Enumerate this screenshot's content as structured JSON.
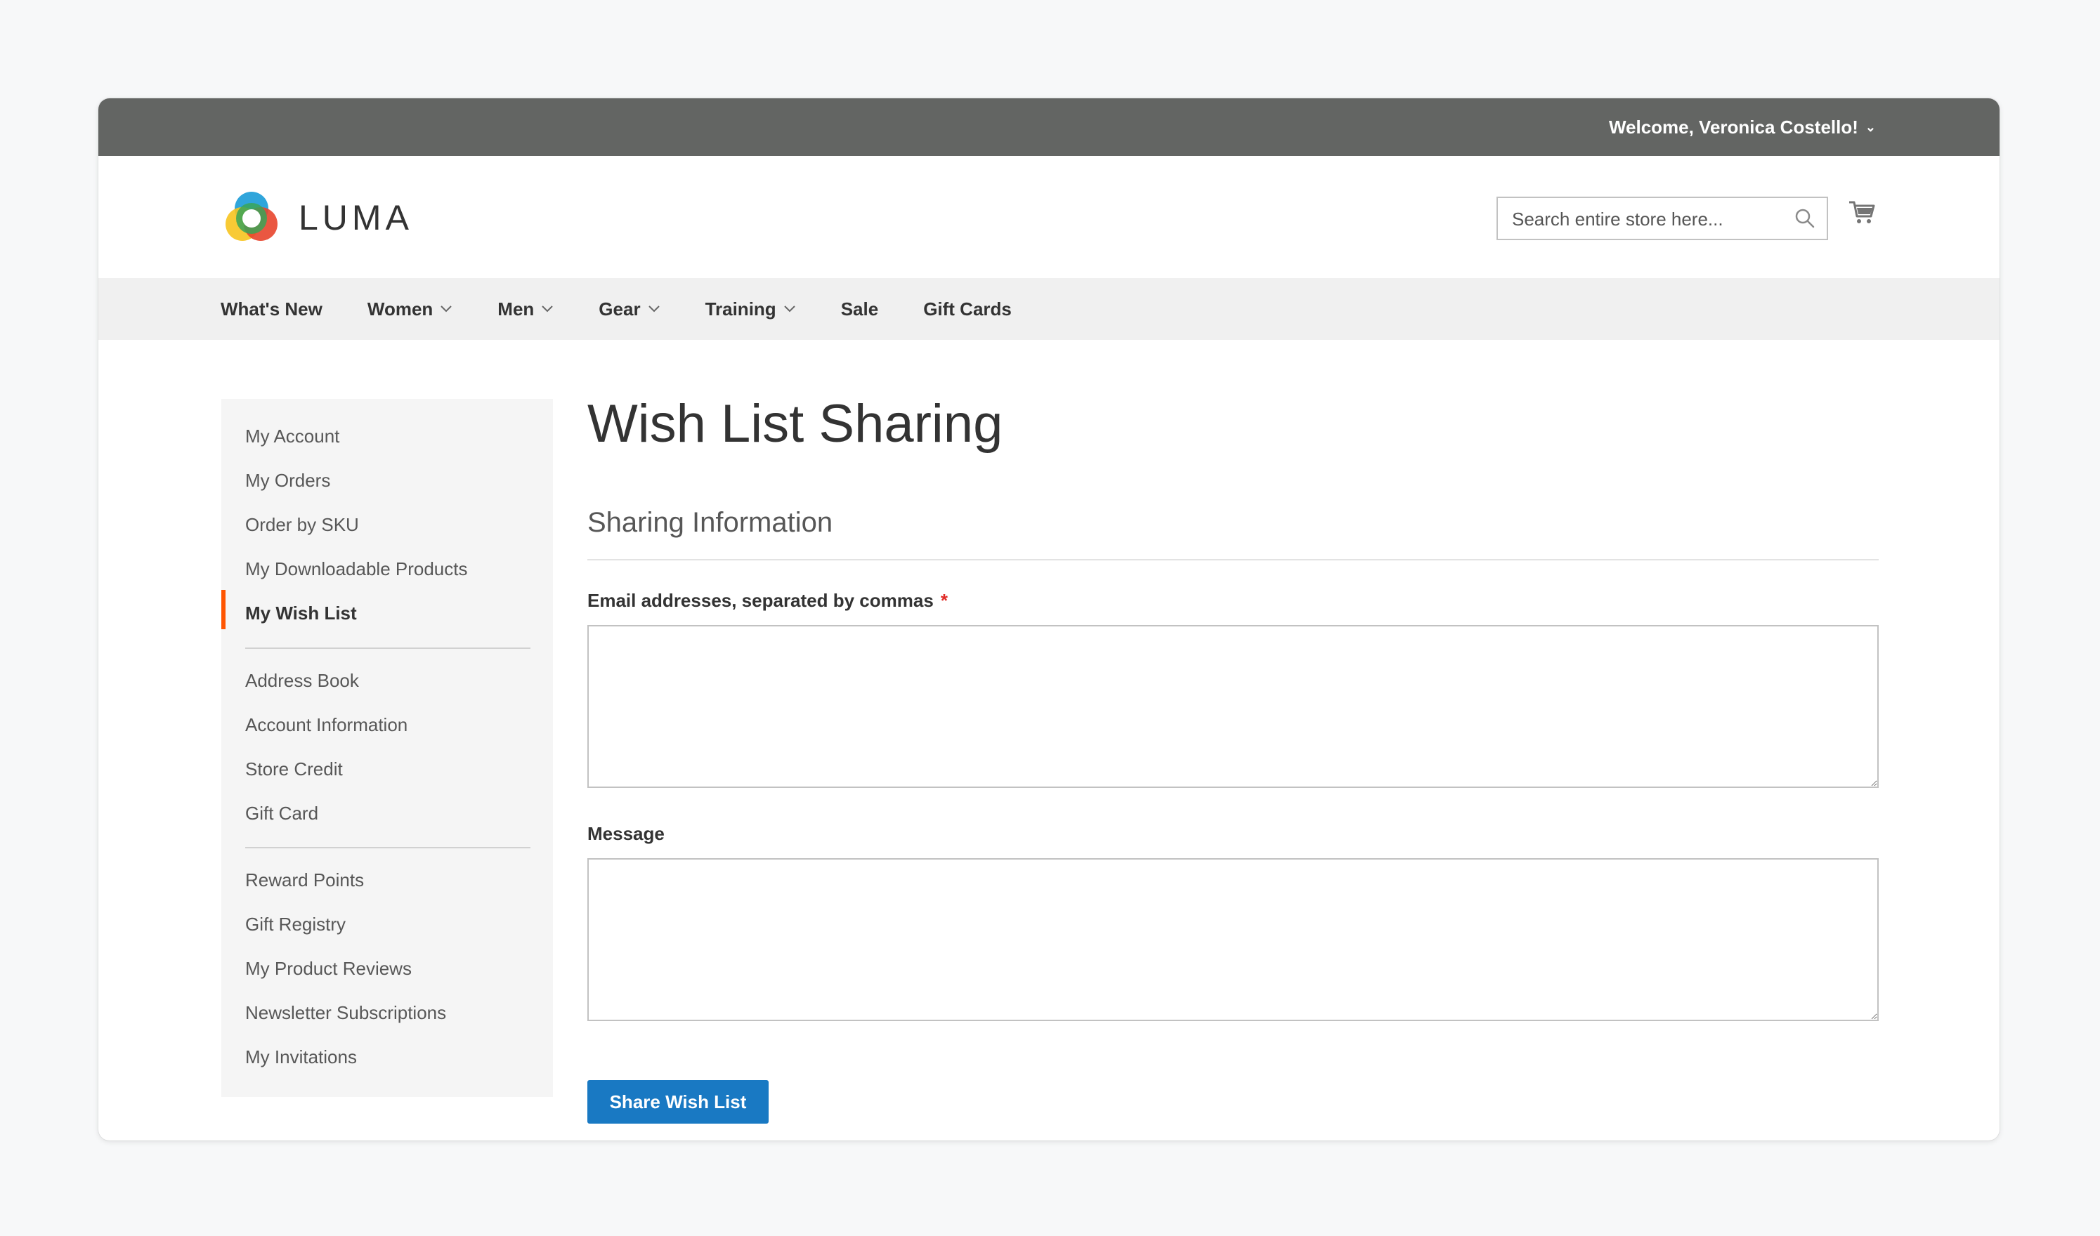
{
  "topbar": {
    "welcome": "Welcome, Veronica Costello!"
  },
  "header": {
    "logo_text": "LUMA",
    "search_placeholder": "Search entire store here..."
  },
  "nav": {
    "items": [
      {
        "label": "What's New",
        "has_dropdown": false
      },
      {
        "label": "Women",
        "has_dropdown": true
      },
      {
        "label": "Men",
        "has_dropdown": true
      },
      {
        "label": "Gear",
        "has_dropdown": true
      },
      {
        "label": "Training",
        "has_dropdown": true
      },
      {
        "label": "Sale",
        "has_dropdown": false
      },
      {
        "label": "Gift Cards",
        "has_dropdown": false
      }
    ]
  },
  "sidebar": {
    "items": [
      {
        "label": "My Account"
      },
      {
        "label": "My Orders"
      },
      {
        "label": "Order by SKU"
      },
      {
        "label": "My Downloadable Products"
      },
      {
        "label": "My Wish List",
        "active": true
      },
      {
        "label": "Address Book"
      },
      {
        "label": "Account Information"
      },
      {
        "label": "Store Credit"
      },
      {
        "label": "Gift Card"
      },
      {
        "label": "Reward Points"
      },
      {
        "label": "Gift Registry"
      },
      {
        "label": "My Product Reviews"
      },
      {
        "label": "Newsletter Subscriptions"
      },
      {
        "label": "My Invitations"
      }
    ]
  },
  "main": {
    "title": "Wish List Sharing",
    "section_title": "Sharing Information",
    "email_label": "Email addresses, separated by commas",
    "required_mark": "*",
    "email_value": "",
    "message_label": "Message",
    "message_value": "",
    "share_button": "Share Wish List"
  },
  "colors": {
    "topbar": "#636563",
    "accent_active": "#ff5501",
    "button": "#1979c3",
    "required": "#e02b27"
  }
}
